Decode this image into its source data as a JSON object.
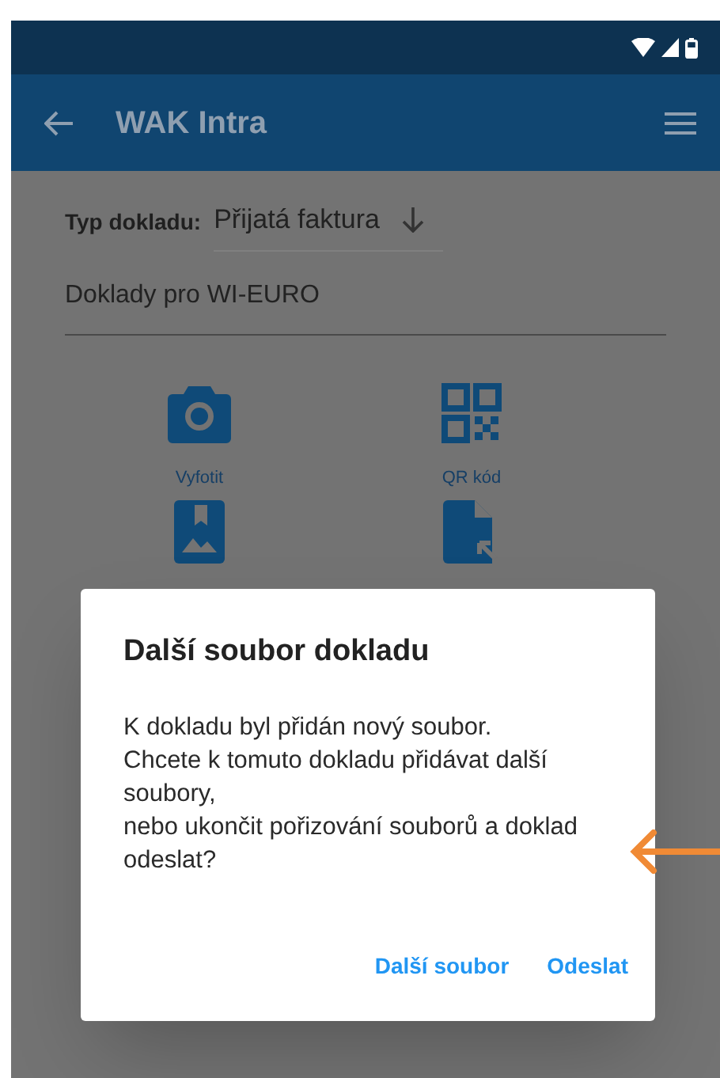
{
  "app_bar": {
    "title": "WAK Intra"
  },
  "form": {
    "doc_type_label": "Typ dokladu:",
    "doc_type_value": "Přijatá faktura",
    "description_value": "Doklady pro WI-EURO"
  },
  "actions": [
    {
      "kind": "camera",
      "label": "Vyfotit"
    },
    {
      "kind": "qr",
      "label": "QR kód"
    },
    {
      "kind": "gallery"
    },
    {
      "kind": "file"
    }
  ],
  "dialog": {
    "title": "Další soubor dokladu",
    "message": "K dokladu byl přidán nový soubor.\nChcete k tomuto dokladu přidávat další soubory,\nnebo ukončit pořizování souborů a doklad odeslat?",
    "buttons": [
      "Další soubor",
      "Odeslat"
    ]
  }
}
